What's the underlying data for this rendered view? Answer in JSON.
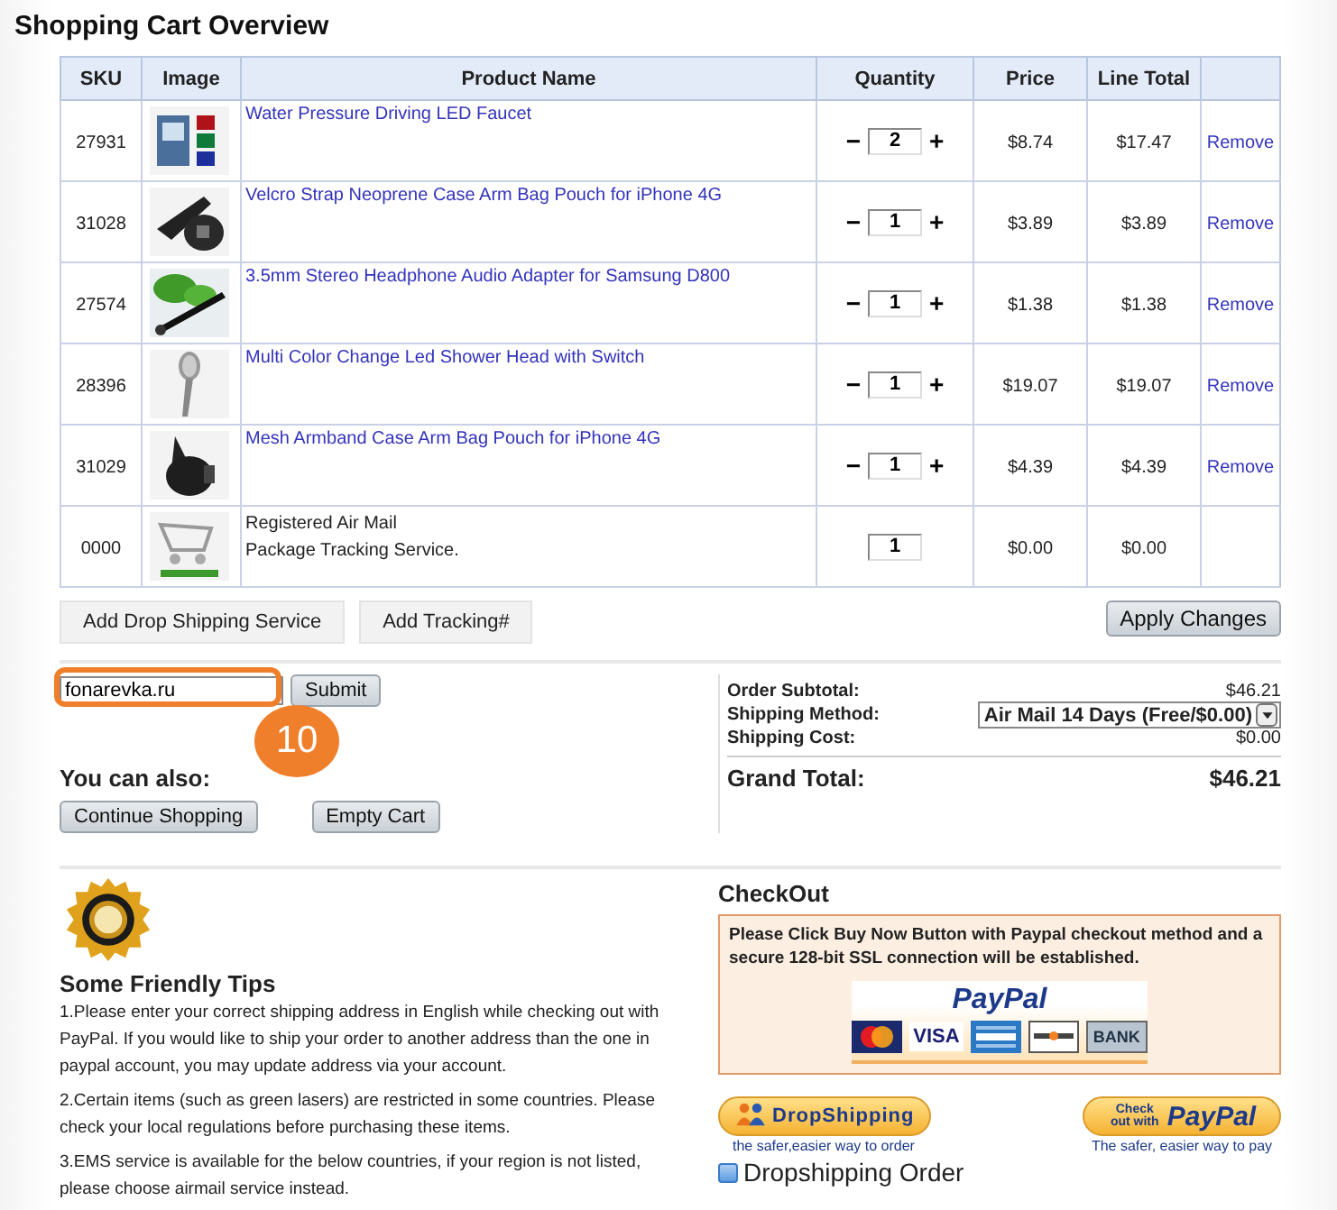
{
  "title": "Shopping Cart Overview",
  "table": {
    "columns": [
      "SKU",
      "Image",
      "Product Name",
      "Quantity",
      "Price",
      "Line Total"
    ],
    "rows": [
      {
        "kind": "product",
        "sku": "27931",
        "name": "Water Pressure Driving LED Faucet",
        "minus": "−",
        "quantity": "2",
        "plus": "+",
        "price": "$8.74",
        "line_total": "$17.47",
        "action": "Remove"
      },
      {
        "kind": "product",
        "sku": "31028",
        "name": "Velcro Strap Neoprene Case Arm Bag Pouch for iPhone 4G",
        "minus": "−",
        "quantity": "1",
        "plus": "+",
        "price": "$3.89",
        "line_total": "$3.89",
        "action": "Remove"
      },
      {
        "kind": "product",
        "sku": "27574",
        "name": "3.5mm Stereo Headphone Audio Adapter for Samsung D800",
        "minus": "−",
        "quantity": "1",
        "plus": "+",
        "price": "$1.38",
        "line_total": "$1.38",
        "action": "Remove"
      },
      {
        "kind": "product",
        "sku": "28396",
        "name": "Multi Color Change Led Shower Head with Switch",
        "minus": "−",
        "quantity": "1",
        "plus": "+",
        "price": "$19.07",
        "line_total": "$19.07",
        "action": "Remove"
      },
      {
        "kind": "product",
        "sku": "31029",
        "name": "Mesh Armband Case Arm Bag Pouch for iPhone 4G",
        "minus": "−",
        "quantity": "1",
        "plus": "+",
        "price": "$4.39",
        "line_total": "$4.39",
        "action": "Remove"
      },
      {
        "kind": "service",
        "sku": "0000",
        "name": "Registered Air Mail",
        "detail": "Package Tracking Service.",
        "quantity": "1",
        "price": "$0.00",
        "line_total": "$0.00"
      }
    ]
  },
  "cart_buttons": [
    "Add Drop Shipping Service",
    "Add Tracking#"
  ],
  "apply_button": "Apply Changes",
  "coupon": {
    "value": "fonarevka.ru",
    "button": "Submit",
    "annotation": "10"
  },
  "also": {
    "heading": "You can also:",
    "buttons": [
      "Continue Shopping",
      "Empty Cart"
    ]
  },
  "summary": {
    "subtotal_label": "Order Subtotal:",
    "subtotal": "$46.21",
    "shipping_label": "Shipping Method:",
    "shipping_method": "Air Mail 14 Days (Free/$0.00)",
    "cost_label": "Shipping Cost:",
    "cost": "$0.00",
    "total_label": "Grand Total:",
    "total": "$46.21"
  },
  "tips": {
    "heading": "Some Friendly Tips",
    "items": [
      "1.Please enter your correct shipping address in English while checking out with PayPal. If you would like to ship your order to another address than the one in paypal account, you may update address via your account.",
      "2.Certain items (such as green lasers) are restricted in some countries. Please check your local regulations before purchasing these items.",
      "3.EMS service is available for the below countries, if your region is not listed, please choose airmail service instead."
    ]
  },
  "checkout": {
    "heading": "CheckOut",
    "notice": "Please Click Buy Now Button with Paypal checkout method and a secure 128-bit SSL connection will be established.",
    "logo": "PayPal",
    "cards": [
      "VISA",
      "BANK"
    ],
    "dropshipping_button": "DropShipping",
    "dropshipping_caption": "the safer,easier way to order",
    "paypal_button_prefix": "Check out with",
    "paypal_button_brand": "PayPal",
    "paypal_caption": "The safer, easier way to pay",
    "dropshipping_order": {
      "label": "Dropshipping Order",
      "checked": false
    }
  }
}
